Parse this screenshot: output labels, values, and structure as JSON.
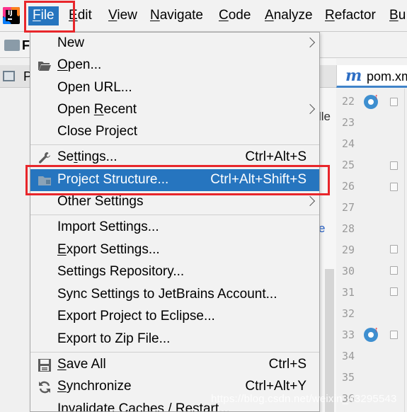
{
  "menubar": {
    "items": [
      "File",
      "Edit",
      "View",
      "Navigate",
      "Code",
      "Analyze",
      "Refactor",
      "Bu"
    ],
    "mnemonics": [
      "F",
      "E",
      "V",
      "N",
      "C",
      "A",
      "R",
      "B"
    ]
  },
  "ide": {
    "project_letter": "F",
    "project_tab_letter": "P",
    "mid_text": "lle",
    "editor_tab": "pom.xm",
    "line_numbers": [
      "22",
      "23",
      "24",
      "25",
      "26",
      "27",
      "28",
      "29",
      "30",
      "31",
      "32",
      "33",
      "34",
      "35",
      "36"
    ]
  },
  "file_menu": {
    "items": [
      {
        "label": "New",
        "shortcut": "",
        "submenu": true
      },
      {
        "label": "Open...",
        "shortcut": "",
        "submenu": false
      },
      {
        "label": "Open URL...",
        "shortcut": "",
        "submenu": false
      },
      {
        "label": "Open Recent",
        "shortcut": "",
        "submenu": true
      },
      {
        "label": "Close Project",
        "shortcut": "",
        "submenu": false
      },
      {
        "label": "Settings...",
        "shortcut": "Ctrl+Alt+S",
        "submenu": false
      },
      {
        "label": "Project Structure...",
        "shortcut": "Ctrl+Alt+Shift+S",
        "submenu": false,
        "highlighted": true
      },
      {
        "label": "Other Settings",
        "shortcut": "",
        "submenu": true
      },
      {
        "label": "Import Settings...",
        "shortcut": "",
        "submenu": false
      },
      {
        "label": "Export Settings...",
        "shortcut": "",
        "submenu": false
      },
      {
        "label": "Settings Repository...",
        "shortcut": "",
        "submenu": false
      },
      {
        "label": "Sync Settings to JetBrains Account...",
        "shortcut": "",
        "submenu": false
      },
      {
        "label": "Export Project to Eclipse...",
        "shortcut": "",
        "submenu": false
      },
      {
        "label": "Export to Zip File...",
        "shortcut": "",
        "submenu": false
      },
      {
        "label": "Save All",
        "shortcut": "Ctrl+S",
        "submenu": false
      },
      {
        "label": "Synchronize",
        "shortcut": "Ctrl+Alt+Y",
        "submenu": false
      },
      {
        "label": "Invalidate Caches / Restart...",
        "shortcut": "",
        "submenu": false
      }
    ]
  },
  "watermark": "https://blog.csdn.net/weixin_43295543",
  "colors": {
    "highlight": "#2675bf",
    "annotation_red": "#e8262b",
    "menu_bg": "#f2f2f2"
  }
}
